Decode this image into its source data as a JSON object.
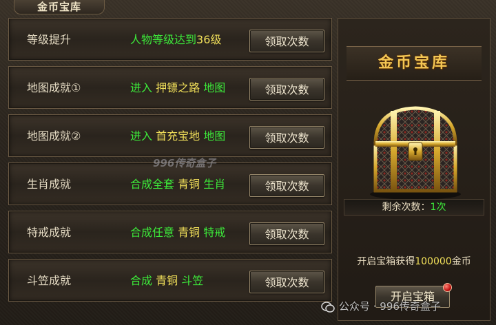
{
  "panel_title": "金币宝库",
  "rows": [
    {
      "name": "等级提升",
      "desc": [
        {
          "t": "人物等级达到",
          "c": "g"
        },
        {
          "t": "36级",
          "c": "y"
        }
      ],
      "button": "领取次数"
    },
    {
      "name": "地图成就①",
      "desc": [
        {
          "t": "进入 ",
          "c": "g"
        },
        {
          "t": "押镖之路",
          "c": "y"
        },
        {
          "t": " 地图",
          "c": "g"
        }
      ],
      "button": "领取次数"
    },
    {
      "name": "地图成就②",
      "desc": [
        {
          "t": "进入 ",
          "c": "g"
        },
        {
          "t": "首充宝地",
          "c": "y"
        },
        {
          "t": " 地图",
          "c": "g"
        }
      ],
      "button": "领取次数"
    },
    {
      "name": "生肖成就",
      "desc": [
        {
          "t": "合成全套 ",
          "c": "g"
        },
        {
          "t": "青铜",
          "c": "y"
        },
        {
          "t": " 生肖",
          "c": "g"
        }
      ],
      "button": "领取次数"
    },
    {
      "name": "特戒成就",
      "desc": [
        {
          "t": "合成任意 ",
          "c": "g"
        },
        {
          "t": "青铜",
          "c": "y"
        },
        {
          "t": " 特戒",
          "c": "g"
        }
      ],
      "button": "领取次数"
    },
    {
      "name": "斗笠成就",
      "desc": [
        {
          "t": "合成 ",
          "c": "g"
        },
        {
          "t": "青铜",
          "c": "y"
        },
        {
          "t": " 斗笠",
          "c": "g"
        }
      ],
      "button": "领取次数"
    }
  ],
  "chest": {
    "title": "金币宝库",
    "remaining_label": "剩余次数：",
    "remaining_value": "1次",
    "reward_prefix": "开启宝箱获得",
    "reward_value": "100000",
    "reward_suffix": "金币",
    "open_button": "开启宝箱",
    "chest_icon": "treasure-chest-icon"
  },
  "watermark_center": "996传奇盒子",
  "watermark_corner": "公众号 · 996传奇盒子",
  "colors": {
    "green": "#3dea3a",
    "yellow": "#f2e05a",
    "gold": "#f3c654"
  }
}
